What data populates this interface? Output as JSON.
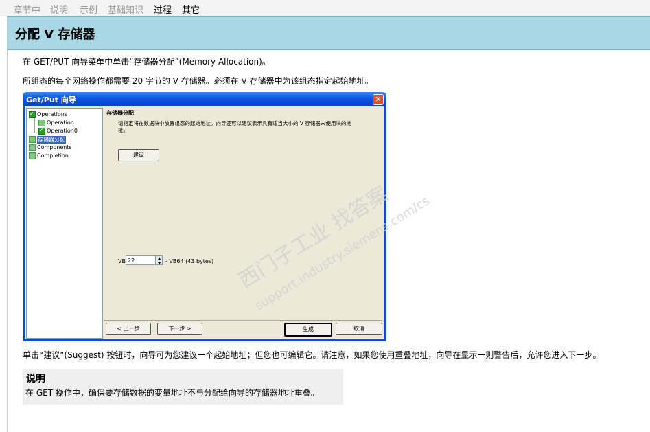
{
  "tabs": [
    {
      "label": "章节中",
      "active": false
    },
    {
      "label": "说明",
      "active": false
    },
    {
      "label": "示例",
      "active": false
    },
    {
      "label": "基础知识",
      "active": false
    },
    {
      "label": "过程",
      "active": true
    },
    {
      "label": "其它",
      "active": true
    }
  ],
  "header": {
    "title": "分配 V 存储器"
  },
  "paragraphs": {
    "p1": "在 GET/PUT 向导菜单中单击“存储器分配”(Memory Allocation)。",
    "p2": "所组态的每个网络操作都需要 20 字节的 V 存储器。必须在 V 存储器中为该组态指定起始地址。",
    "p3": "单击“建议”(Suggest) 按钮时，向导可为您建议一个起始地址；但您也可编辑它。请注意，如果您使用重叠地址，向导在显示一则警告后，允许您进入下一步。"
  },
  "dialog": {
    "title": "Get/Put 向导",
    "close_glyph": "✕",
    "tree": [
      {
        "label": "Operations",
        "checked": true,
        "selected": false
      },
      {
        "label": "Operation",
        "checked": false,
        "selected": false
      },
      {
        "label": "Operation0",
        "checked": true,
        "selected": false
      },
      {
        "label": "存储器分配",
        "checked": false,
        "selected": true
      },
      {
        "label": "Components",
        "checked": false,
        "selected": false
      },
      {
        "label": "Completion",
        "checked": false,
        "selected": false
      }
    ],
    "section_title": "存储器分配",
    "description": "请指定将在数据块中放置组态的起始地址。向导还可以建议表示具有适当大小的 V 存储器未使用块的地址。",
    "suggest_label": "建议",
    "vb_label": "VB",
    "vb_value": "22",
    "vb_range": "- VB64 (43 bytes)",
    "prev_label": "< 上一步",
    "next_label": "下一步 >",
    "generate_label": "生成",
    "cancel_label": "取消"
  },
  "watermark": {
    "line1": "西门子工业  找答案",
    "line2": "support.industry.siemens.com/cs"
  },
  "note": {
    "title": "说明",
    "body": "在 GET 操作中，确保要存储数据的变量地址不与分配给向导的存储器地址重叠。"
  },
  "colors": {
    "header_bg": "#a9d7e4",
    "dialog_title": "#0a56e2",
    "dialog_face": "#ece9d8",
    "tree_selected": "#316ac5",
    "check_green": "#2e9b2e"
  }
}
